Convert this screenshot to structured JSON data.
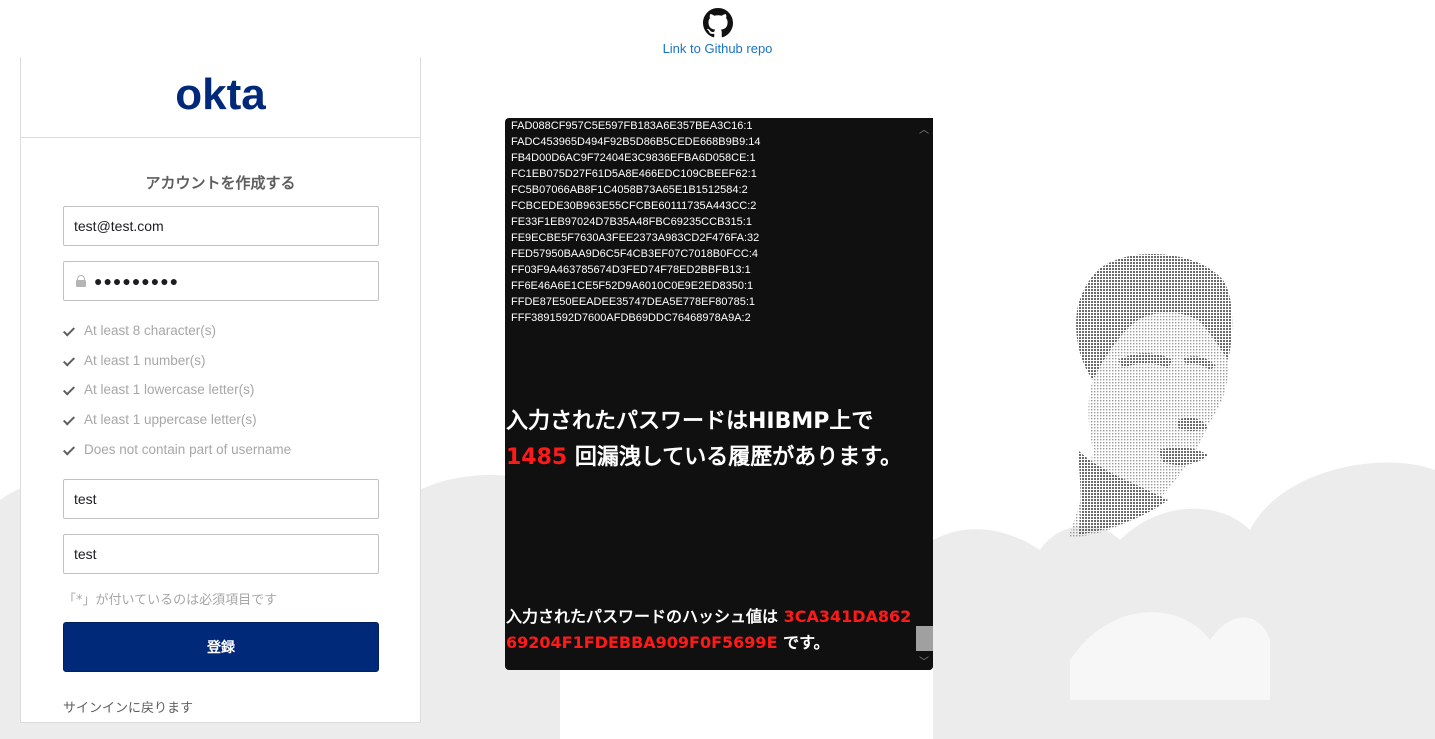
{
  "header": {
    "github_icon": "github-icon",
    "github_link": "Link to Github repo"
  },
  "card": {
    "logo": "okta",
    "title": "アカウントを作成する",
    "email_value": "test@test.com",
    "password_value": "●●●●●●●●●",
    "requirements": [
      "At least 8 character(s)",
      "At least 1 number(s)",
      "At least 1 lowercase letter(s)",
      "At least 1 uppercase letter(s)",
      "Does not contain part of username"
    ],
    "first_name_value": "test",
    "last_name_value": "test",
    "required_note": "「*」が付いているのは必須項目です",
    "submit_label": "登録",
    "back_link": "サインインに戻ります"
  },
  "panel": {
    "hashes": [
      "FAD088CF957C5E597FB183A6E357BEA3C16:1",
      "FADC453965D494F92B5D86B5CEDE668B9B9:14",
      "FB4D00D6AC9F72404E3C9836EFBA6D058CE:1",
      "FC1EB075D27F61D5A8E466EDC109CBEEF62:1",
      "FC5B07066AB8F1C4058B73A65E1B1512584:2",
      "FCBCEDE30B963E55CFCBE60111735A443CC:2",
      "FE33F1EB97024D7B35A48FBC69235CCB315:1",
      "FE9ECBE5F7630A3FEE2373A983CD2F476FA:32",
      "FED57950BAA9D6C5F4CB3EF07C7018B0FCC:4",
      "FF03F9A463785674D3FED74F78ED2BBFB13:1",
      "FF6E46A6E1CE5F52D9A6010C0E9E2ED8350:1",
      "FFDE87E50EEADEE35747DEA5E778EF80785:1",
      "FFF3891592D7600AFDB69DDC76468978A9A:2"
    ],
    "leak_prefix": "入力されたパスワードはHIBMP上で",
    "leak_count": "1485",
    "leak_suffix": " 回漏洩している履歴があります。",
    "hash_prefix": "入力されたパスワードのハッシュ値は ",
    "hash_value": "3CA341DA86269204F1FDEBBA909F0F5699E",
    "hash_suffix": " です。"
  },
  "colors": {
    "okta_blue": "#00297a",
    "leak_red": "#ff1a1a",
    "panel_bg": "#101010",
    "link_blue": "#1a73c8"
  }
}
